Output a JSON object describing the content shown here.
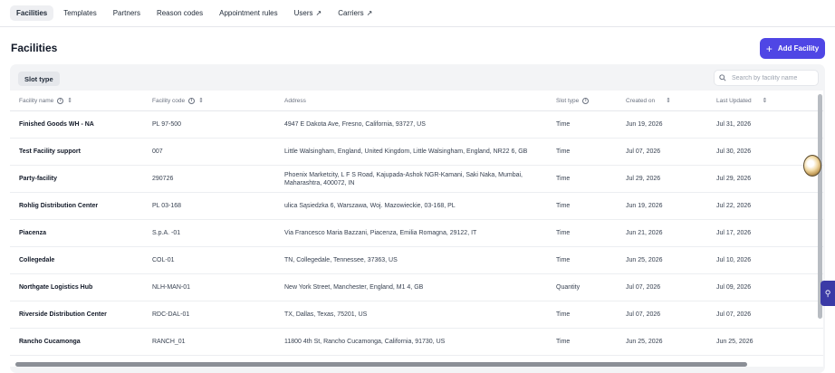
{
  "nav": {
    "tabs": [
      {
        "label": "Facilities",
        "active": true
      },
      {
        "label": "Templates"
      },
      {
        "label": "Partners"
      },
      {
        "label": "Reason codes"
      },
      {
        "label": "Appointment rules"
      },
      {
        "label": "Users",
        "external": true
      },
      {
        "label": "Carriers",
        "external": true
      }
    ],
    "external_glyph": "↗"
  },
  "page": {
    "title": "Facilities",
    "add_button": {
      "label": "Add Facility",
      "icon": "plus-icon"
    }
  },
  "filters": {
    "slot_type_chip": "Slot type",
    "search_placeholder": "Search by facility name"
  },
  "table": {
    "columns": [
      {
        "label": "Facility name",
        "info": true,
        "sort": true
      },
      {
        "label": "Facility code",
        "info": true,
        "sort": true
      },
      {
        "label": "Address",
        "info": false,
        "sort": false
      },
      {
        "label": "Slot type",
        "info": true,
        "sort": false
      },
      {
        "label": "Created on",
        "info": false,
        "sort": true
      },
      {
        "label": "Last Updated",
        "info": false,
        "sort": true
      }
    ],
    "rows": [
      {
        "name": "Finished Goods WH - NA",
        "code": "PL 97-500",
        "address": "4947 E Dakota Ave, Fresno, California, 93727, US",
        "slot_type": "Time",
        "created": "Jun 19, 2026",
        "updated": "Jul 31, 2026"
      },
      {
        "name": "Test Facility support",
        "code": "007",
        "address": "Little Walsingham, England, United Kingdom, Little Walsingham, England, NR22 6, GB",
        "slot_type": "Time",
        "created": "Jul 07, 2026",
        "updated": "Jul 30, 2026"
      },
      {
        "name": "Party-facility",
        "code": "290726",
        "address": "Phoenix Marketcity, L F S Road, Kajupada-Ashok NGR-Kamani, Saki Naka, Mumbai, Maharashtra, 400072, IN",
        "slot_type": "Time",
        "created": "Jul 29, 2026",
        "updated": "Jul 29, 2026"
      },
      {
        "name": "Rohlig Distribution Center",
        "code": "PL 03-168",
        "address": "ulica Sąsiedzka 6, Warszawa, Woj. Mazowieckie, 03-168, PL",
        "slot_type": "Time",
        "created": "Jun 19, 2026",
        "updated": "Jul 22, 2026"
      },
      {
        "name": "Piacenza",
        "code": "S.p.A. -01",
        "address": "Via Francesco Maria Bazzani, Piacenza, Emilia Romagna, 29122, IT",
        "slot_type": "Time",
        "created": "Jun 21, 2026",
        "updated": "Jul 17, 2026"
      },
      {
        "name": "Collegedale",
        "code": "COL-01",
        "address": "TN, Collegedale, Tennessee, 37363, US",
        "slot_type": "Time",
        "created": "Jun 25, 2026",
        "updated": "Jul 10, 2026"
      },
      {
        "name": "Northgate Logistics Hub",
        "code": "NLH-MAN-01",
        "address": "New York Street, Manchester, England, M1 4, GB",
        "slot_type": "Quantity",
        "created": "Jul 07, 2026",
        "updated": "Jul 09, 2026"
      },
      {
        "name": "Riverside Distribution Center",
        "code": "RDC-DAL-01",
        "address": "TX, Dallas, Texas, 75201, US",
        "slot_type": "Time",
        "created": "Jul 07, 2026",
        "updated": "Jul 07, 2026"
      },
      {
        "name": "Rancho Cucamonga",
        "code": "RANCH_01",
        "address": "11800 4th St, Rancho Cucamonga, California, 91730, US",
        "slot_type": "Time",
        "created": "Jun 25, 2026",
        "updated": "Jun 25, 2026"
      }
    ]
  },
  "glyphs": {
    "info": "i",
    "sort": "⇕"
  },
  "colors": {
    "accent": "#4f46e5",
    "widget": "#3b3aa6"
  }
}
